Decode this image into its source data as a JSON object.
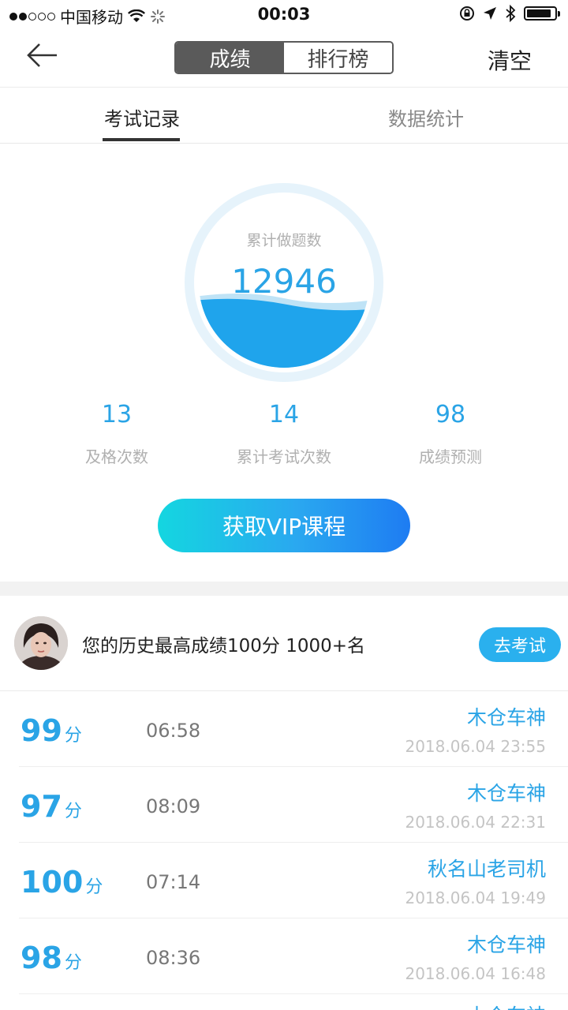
{
  "status_bar": {
    "carrier": "中国移动",
    "time": "00:03"
  },
  "nav": {
    "segments": [
      "成绩",
      "排行榜"
    ],
    "clear_label": "清空"
  },
  "tabs": [
    "考试记录",
    "数据统计"
  ],
  "summary": {
    "label": "累计做题数",
    "value": "12946"
  },
  "stats": [
    {
      "value": "13",
      "label": "及格次数"
    },
    {
      "value": "14",
      "label": "累计考试次数"
    },
    {
      "value": "98",
      "label": "成绩预测"
    }
  ],
  "vip_button": "获取VIP课程",
  "best": {
    "text": "您的历史最高成绩100分 1000+名",
    "button": "去考试"
  },
  "score_unit": "分",
  "records": [
    {
      "score": "99",
      "duration": "06:58",
      "name": "木仓车神",
      "date": "2018.06.04 23:55"
    },
    {
      "score": "97",
      "duration": "08:09",
      "name": "木仓车神",
      "date": "2018.06.04 22:31"
    },
    {
      "score": "100",
      "duration": "07:14",
      "name": "秋名山老司机",
      "date": "2018.06.04 19:49"
    },
    {
      "score": "98",
      "duration": "08:36",
      "name": "木仓车神",
      "date": "2018.06.04 16:48"
    },
    {
      "score": "",
      "duration": "",
      "name": "木仓车神",
      "date": ""
    }
  ],
  "colors": {
    "accent": "#2aa4e6",
    "segment_active": "#5a5a5a"
  }
}
